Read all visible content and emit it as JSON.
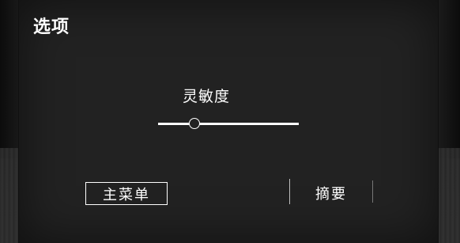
{
  "options_panel": {
    "title": "选项",
    "sensitivity": {
      "label": "灵敏度",
      "value": 0.26
    },
    "main_menu_button": "主菜单",
    "summary_button": "摘要"
  }
}
